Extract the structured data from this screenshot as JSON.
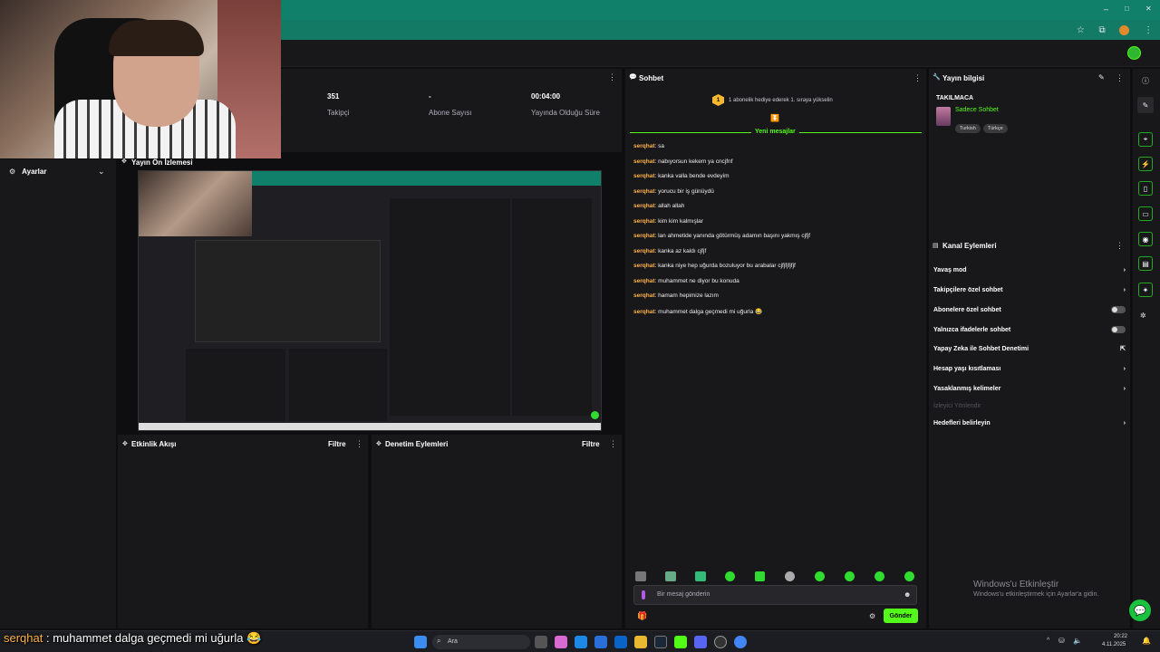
{
  "browser": {
    "controls": [
      "–",
      "□",
      "✕"
    ]
  },
  "stats": [
    {
      "value": "351",
      "label": "Takipçi"
    },
    {
      "value": "-",
      "label": "Abone Sayısı"
    },
    {
      "value": "00:04:00",
      "label": "Yayında Olduğu Süre"
    }
  ],
  "left_rail": {
    "title": "Ayarlar"
  },
  "preview": {
    "title": "Yayın Ön İzlemesi"
  },
  "activity": {
    "title": "Etkinlik Akışı",
    "filter": "Filtre"
  },
  "moderation": {
    "title": "Denetim Eylemleri",
    "filter": "Filtre"
  },
  "chat": {
    "title": "Sohbet",
    "gift_rank": "1",
    "gift_banner": "1 abonelik hediye ederek 1. sıraya yükselin",
    "new_messages": "Yeni mesajlar",
    "messages": [
      {
        "user": "serqhat",
        "text": "sa"
      },
      {
        "user": "serqhat",
        "text": "nabıyorsun kekem ya cncjfnf"
      },
      {
        "user": "serqhat",
        "text": "kanka valla bende evdeyim"
      },
      {
        "user": "serqhat",
        "text": "yorucu bir iş günüydü"
      },
      {
        "user": "serqhat",
        "text": "allah allah"
      },
      {
        "user": "serqhat",
        "text": "kim kim kalmışlar"
      },
      {
        "user": "serqhat",
        "text": "lan ahmetide yanında götürmüş adamın başını yakmış cjfjf"
      },
      {
        "user": "serqhat",
        "text": "kanka az kaldı cjfjf"
      },
      {
        "user": "serqhat",
        "text": "kanka niye hep uğurda bozuluyor bu arabalar cjfjfjfjfjf"
      },
      {
        "user": "serqhat",
        "text": "muhammet ne diyor bu konuda"
      },
      {
        "user": "serqhat",
        "text": "hamam hepimize lazım"
      },
      {
        "user": "serqhat",
        "text": "muhammet dalga geçmedi mi uğurla 😂"
      }
    ],
    "input_placeholder": "Bir mesaj gönderin",
    "send_label": "Gönder"
  },
  "info": {
    "title": "Yayın bilgisi",
    "stream_title": "TAKILMACA",
    "category": "Sadece Sohbet",
    "tags": [
      "Turkish",
      "Türkçe"
    ]
  },
  "actions": {
    "title": "Kanal Eylemleri",
    "items": [
      {
        "label": "Yavaş mod"
      },
      {
        "label": "Takipçilere özel sohbet"
      },
      {
        "label": "Abonelere özel sohbet"
      },
      {
        "label": "Yalnızca ifadelerle sohbet"
      },
      {
        "label": "Yapay Zeka ile Sohbet Denetimi"
      },
      {
        "label": "Hesap yaşı kısıtlaması"
      },
      {
        "label": "Yasaklanmış kelimeler"
      },
      {
        "label": "İzleyici Yönlendir"
      },
      {
        "label": "Hedefleri belirleyin"
      }
    ]
  },
  "watermark": {
    "line1": "Windows'u Etkinleştir",
    "line2": "Windows'u etkinleştirmek için Ayarlar'a gidin."
  },
  "overlay_caption": {
    "user": "serqhat",
    "text": " : muhammet dalga geçmedi mi uğurla 😂"
  },
  "taskbar": {
    "search_label": "Ara",
    "time": "20:22",
    "date": "4.11.2025"
  },
  "colors": {
    "accent": "#53fc18",
    "teal": "#11806a",
    "panel": "#18181b"
  }
}
